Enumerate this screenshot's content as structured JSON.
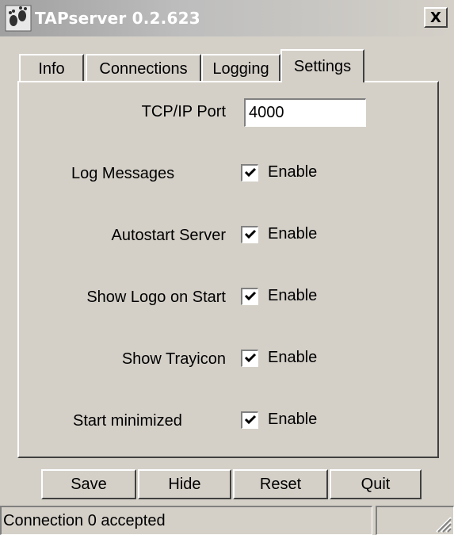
{
  "window": {
    "title": "TAPserver 0.2.623",
    "close_glyph": "X"
  },
  "tabs": [
    {
      "label": "Info",
      "active": false
    },
    {
      "label": "Connections",
      "active": false
    },
    {
      "label": "Logging",
      "active": false
    },
    {
      "label": "Settings",
      "active": true
    }
  ],
  "settings": {
    "port_label": "TCP/IP Port",
    "port_value": "4000",
    "options": [
      {
        "label": "Log Messages",
        "checkbox_label": "Enable",
        "checked": true
      },
      {
        "label": "Autostart Server",
        "checkbox_label": "Enable",
        "checked": true
      },
      {
        "label": "Show Logo on Start",
        "checkbox_label": "Enable",
        "checked": true
      },
      {
        "label": "Show Trayicon",
        "checkbox_label": "Enable",
        "checked": true
      },
      {
        "label": "Start minimized",
        "checkbox_label": "Enable",
        "checked": true
      }
    ]
  },
  "buttons": {
    "save": "Save",
    "hide": "Hide",
    "reset": "Reset",
    "quit": "Quit"
  },
  "statusbar": {
    "message": "Connection 0 accepted",
    "secondary": ""
  },
  "icons": {
    "app": "tap-footprints-icon",
    "close": "close-icon",
    "check": "checkmark-icon",
    "grip": "resize-grip-icon"
  }
}
